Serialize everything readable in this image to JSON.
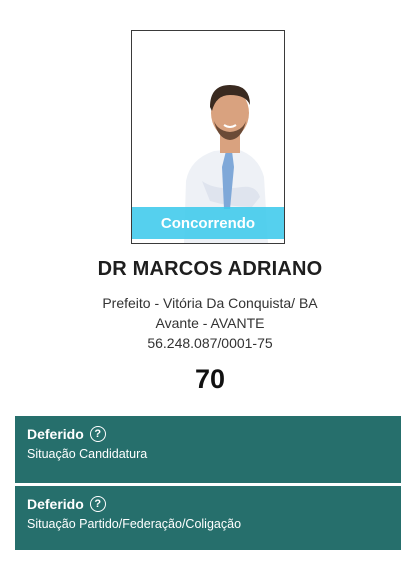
{
  "candidate": {
    "status_banner": "Concorrendo",
    "name": "DR MARCOS ADRIANO",
    "office_location": "Prefeito - Vitória Da Conquista/ BA",
    "party": "Avante - AVANTE",
    "cnpj": "56.248.087/0001-75",
    "number": "70"
  },
  "cards": [
    {
      "title": "Deferido",
      "subtitle": "Situação Candidatura",
      "icon": "help-circle-icon"
    },
    {
      "title": "Deferido",
      "subtitle": "Situação Partido/Federação/Coligação",
      "icon": "help-circle-icon"
    }
  ],
  "colors": {
    "banner": "#3ecaec",
    "card_background": "#266f6c"
  }
}
